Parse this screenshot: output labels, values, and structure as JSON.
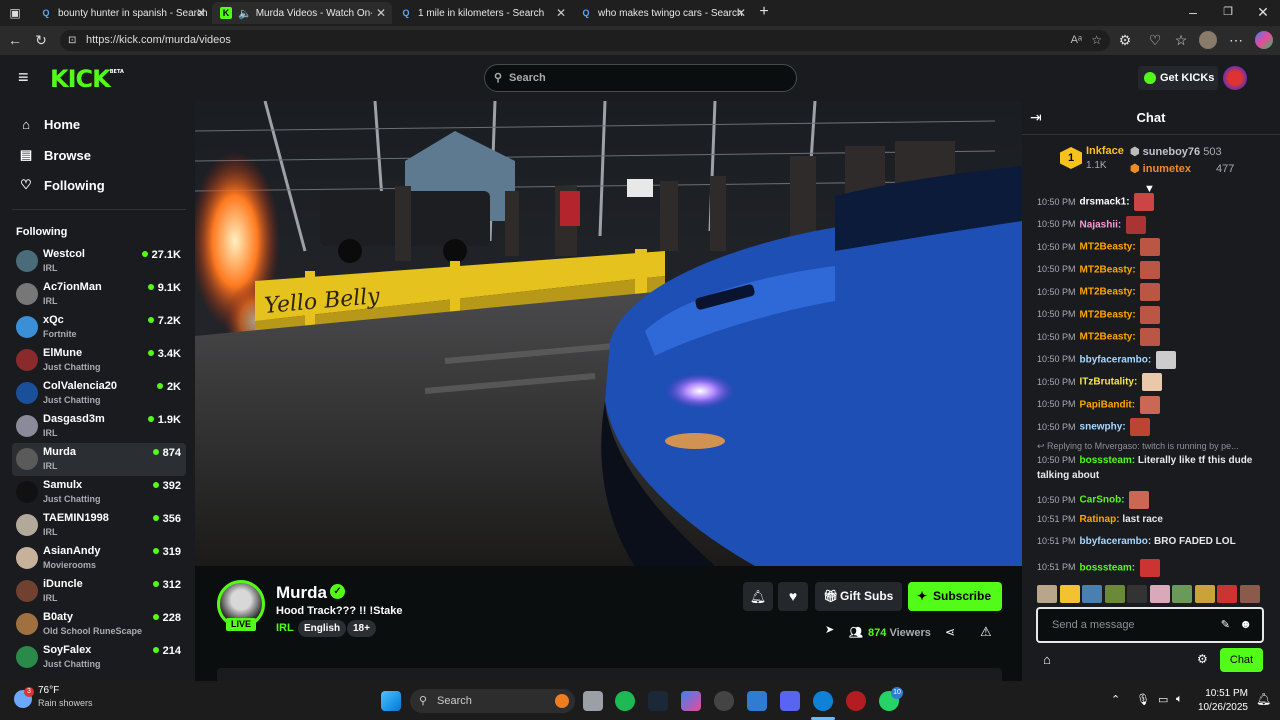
{
  "browser": {
    "tabs": [
      {
        "title": "bounty hunter in spanish - Search",
        "active": false
      },
      {
        "title": "Murda Videos - Watch On-D",
        "active": true
      },
      {
        "title": "1 mile in kilometers - Search",
        "active": false
      },
      {
        "title": "who makes twingo cars - Search",
        "active": false
      }
    ],
    "url": "https://kick.com/murda/videos"
  },
  "header": {
    "logo": "KICK",
    "logo_badge": "BETA",
    "search_placeholder": "Search",
    "get_kicks_label": "Get KICKs"
  },
  "sidebar": {
    "nav": [
      {
        "label": "Home"
      },
      {
        "label": "Browse"
      },
      {
        "label": "Following"
      }
    ],
    "following_title": "Following",
    "channels": [
      {
        "name": "Westcol",
        "category": "IRL",
        "viewers": "27.1K"
      },
      {
        "name": "Ac7ionMan",
        "category": "IRL",
        "viewers": "9.1K"
      },
      {
        "name": "xQc",
        "category": "Fortnite",
        "viewers": "7.2K"
      },
      {
        "name": "ElMune",
        "category": "Just Chatting",
        "viewers": "3.4K"
      },
      {
        "name": "ColValencia20",
        "category": "Just Chatting",
        "viewers": "2K"
      },
      {
        "name": "Dasgasd3m",
        "category": "IRL",
        "viewers": "1.9K"
      },
      {
        "name": "Murda",
        "category": "IRL",
        "viewers": "874"
      },
      {
        "name": "Samulx",
        "category": "Just Chatting",
        "viewers": "392"
      },
      {
        "name": "TAEMIN1998",
        "category": "IRL",
        "viewers": "356"
      },
      {
        "name": "AsianAndy",
        "category": "Movierooms",
        "viewers": "319"
      },
      {
        "name": "iDuncle",
        "category": "IRL",
        "viewers": "312"
      },
      {
        "name": "B0aty",
        "category": "Old School RuneScape",
        "viewers": "228"
      },
      {
        "name": "SoyFalex",
        "category": "Just Chatting",
        "viewers": "214"
      }
    ]
  },
  "stream": {
    "channel": "Murda",
    "title": "Hood Track??? !! !Stake",
    "category": "IRL",
    "tags": [
      "English",
      "18+"
    ],
    "live_badge": "LIVE",
    "gift_subs_label": "Gift Subs",
    "subscribe_label": "Subscribe",
    "viewers": "874",
    "viewers_label": "Viewers",
    "video_text": "Yello Belly"
  },
  "chat": {
    "title": "Chat",
    "leaderboard": {
      "rank": "1",
      "top_user": "Inkface",
      "top_amount": "1.1K",
      "others": [
        {
          "name": "suneboy76",
          "amount": "503"
        },
        {
          "name": "inumetex",
          "amount": "477"
        }
      ]
    },
    "messages": [
      {
        "time": "10:50 PM",
        "user": "drsmack1",
        "text": "",
        "color": "#ffffff"
      },
      {
        "time": "10:50 PM",
        "user": "Najashii",
        "text": "",
        "color": "#ff9ad5"
      },
      {
        "time": "10:50 PM",
        "user": "MT2Beasty",
        "text": "",
        "color": "#ffa500"
      },
      {
        "time": "10:50 PM",
        "user": "MT2Beasty",
        "text": "",
        "color": "#ffa500"
      },
      {
        "time": "10:50 PM",
        "user": "MT2Beasty",
        "text": "",
        "color": "#ffa500"
      },
      {
        "time": "10:50 PM",
        "user": "MT2Beasty",
        "text": "",
        "color": "#ffa500"
      },
      {
        "time": "10:50 PM",
        "user": "MT2Beasty",
        "text": "",
        "color": "#ffa500"
      },
      {
        "time": "10:50 PM",
        "user": "bbyfacerambo",
        "text": "",
        "color": "#a8d8ff"
      },
      {
        "time": "10:50 PM",
        "user": "ITzBrutality",
        "text": "",
        "color": "#ffe14d"
      },
      {
        "time": "10:50 PM",
        "user": "PapiBandit",
        "text": "",
        "color": "#ffa500"
      },
      {
        "time": "10:50 PM",
        "user": "snewphy",
        "text": "",
        "color": "#a8d8ff"
      }
    ],
    "reply_note": "Replying to Mrvergaso: twitch is running by pe...",
    "reply_message": {
      "time": "10:50 PM",
      "user": "bosssteam",
      "text": "Literally like tf this dude talking about",
      "text2": "talking about",
      "color": "#53fc18"
    },
    "messages2": [
      {
        "time": "10:50 PM",
        "user": "CarSnob",
        "text": "",
        "color": "#53fc18"
      },
      {
        "time": "10:51 PM",
        "user": "Ratinap",
        "text": "last race",
        "color": "#ffa500"
      },
      {
        "time": "10:51 PM",
        "user": "bbyfacerambo",
        "text": "BRO FADED LOL",
        "color": "#a8d8ff"
      },
      {
        "time": "10:51 PM",
        "user": "bosssteam",
        "text": "",
        "color": "#53fc18"
      }
    ],
    "input_placeholder": "Send a message",
    "send_label": "Chat"
  },
  "taskbar": {
    "weather_temp": "76°F",
    "weather_desc": "Rain showers",
    "weather_badge": "3",
    "search_placeholder": "Search",
    "whatsapp_badge": "10",
    "time": "10:51 PM",
    "date": "10/26/2025"
  }
}
